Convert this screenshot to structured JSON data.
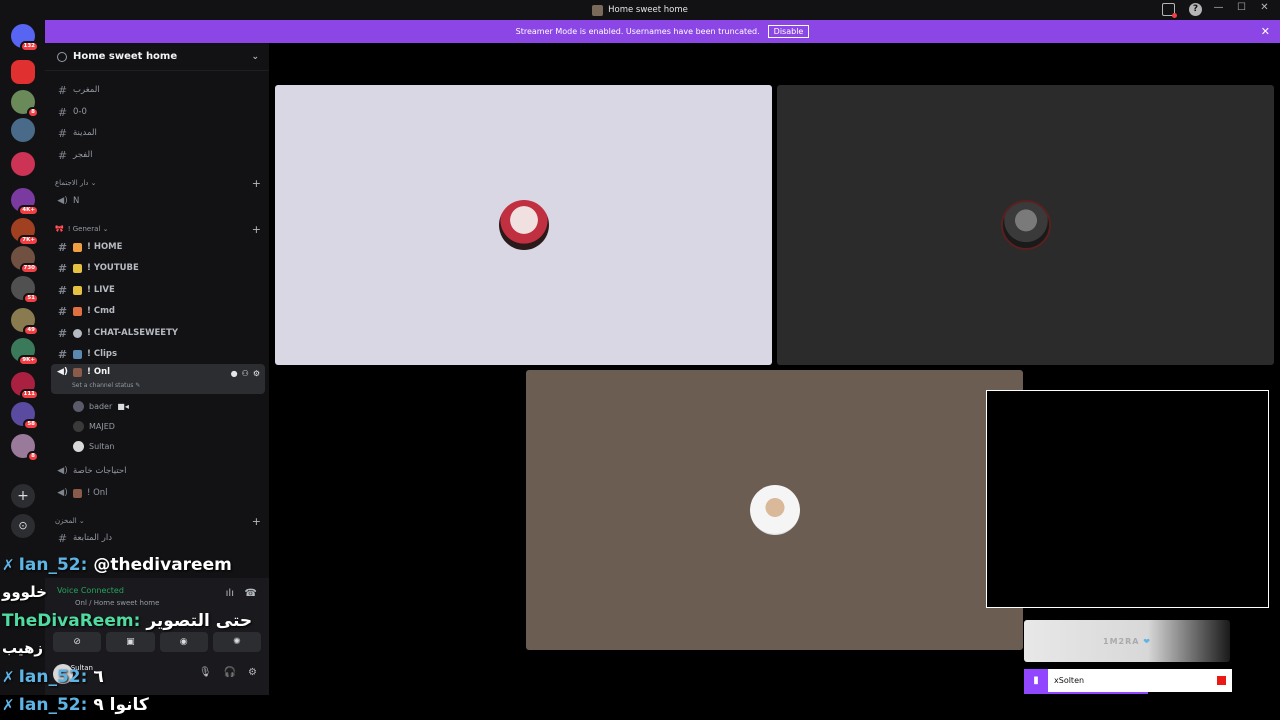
{
  "window": {
    "title": "Home sweet home"
  },
  "banner": {
    "text": "Streamer Mode is enabled. Usernames have been truncated.",
    "button": "Disable"
  },
  "server_rail": {
    "servers": [
      {
        "name": "direct-messages",
        "badge": "132",
        "color": "#5865f2"
      },
      {
        "name": "server-ca",
        "badge": "",
        "color": "#e03030"
      },
      {
        "name": "server-2",
        "badge": "8",
        "color": "#6a8a5a"
      },
      {
        "name": "server-3",
        "badge": "",
        "color": "#4a6a8a"
      },
      {
        "name": "server-4",
        "badge": "",
        "color": "#cc3355"
      },
      {
        "name": "server-5",
        "badge": "4K+",
        "color": "#7a3aa0"
      },
      {
        "name": "server-6",
        "badge": "7K+",
        "color": "#a04020"
      },
      {
        "name": "server-7",
        "badge": "730",
        "color": "#705040"
      },
      {
        "name": "server-8",
        "badge": "51",
        "color": "#505050"
      },
      {
        "name": "server-9",
        "badge": "49",
        "color": "#8a7a50"
      },
      {
        "name": "server-10",
        "badge": "9K+",
        "color": "#3a7a5a"
      },
      {
        "name": "server-11",
        "badge": "111",
        "color": "#aa2040"
      },
      {
        "name": "server-12",
        "badge": "58",
        "color": "#5a4aa0"
      },
      {
        "name": "server-13",
        "badge": "8",
        "color": "#9a7a9a"
      }
    ]
  },
  "sidebar": {
    "server_name": "Home sweet home",
    "channels_top": [
      {
        "name": "المغرب",
        "type": "text"
      },
      {
        "name": "0-0",
        "type": "text"
      },
      {
        "name": "المدينة",
        "type": "text"
      },
      {
        "name": "الفجر",
        "type": "text"
      }
    ],
    "category_meeting": "دار الاجتماع",
    "voice_n": "N",
    "category_general": "! General",
    "channels_general": [
      {
        "name": "! HOME",
        "emoji_color": "#f0a040"
      },
      {
        "name": "! YOUTUBE",
        "emoji_color": "#e6c040"
      },
      {
        "name": "! LIVE",
        "emoji_color": "#e6c040"
      },
      {
        "name": "! Cmd",
        "emoji_color": "#e07040"
      },
      {
        "name": "! CHAT-ALSEWEETY",
        "emoji_color": "#b5bac1"
      },
      {
        "name": "! Clips",
        "emoji_color": "#5a8ab0"
      }
    ],
    "active_voice": {
      "name": "! Onl",
      "status": "Set a channel status ✎"
    },
    "voice_users": [
      {
        "name": "bader",
        "color": "#5a5a6a"
      },
      {
        "name": "MAJED",
        "color": "#3a3a3a"
      },
      {
        "name": "Sultan",
        "color": "#d8d8d8"
      }
    ],
    "voice_private": "احتياجات خاصة",
    "voice_onl2": "! Onl",
    "category_store": "المخزن",
    "channel_store": "دار المتابعة",
    "panel": {
      "voice_connected": "Voice Connected",
      "voice_sub": "Onl / Home sweet home",
      "user_name": "Sultan"
    }
  },
  "stage": {
    "tiles": [
      {
        "name": "tile-1",
        "bg": "#d9d7e4",
        "avatar": "#c03040"
      },
      {
        "name": "tile-2",
        "bg": "#2a2b2a",
        "avatar": "#4a4a4a"
      },
      {
        "name": "tile-3",
        "bg": "#6b5d51",
        "avatar": "#f0f0f0"
      }
    ],
    "overlay_text": "1M2RA",
    "twitch_name": "xSolten"
  },
  "chat": [
    {
      "user": "Ian_52",
      "msg": "@thedivareem",
      "green": false
    },
    {
      "user": "",
      "msg": "خلووو",
      "green": false
    },
    {
      "user": "TheDivaReem",
      "msg": "حتى التصوير",
      "green": true
    },
    {
      "user": "",
      "msg": "زهيب",
      "green": false
    },
    {
      "user": "Ian_52",
      "msg": "٦",
      "green": false
    },
    {
      "user": "Ian_52",
      "msg": "كانوا ٩",
      "green": false
    }
  ]
}
